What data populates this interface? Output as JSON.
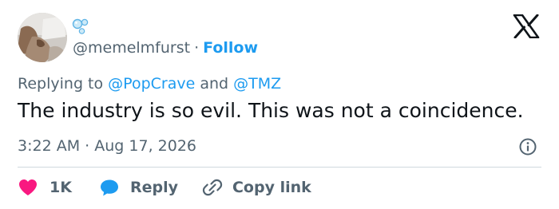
{
  "tweet": {
    "author": {
      "handle": "@memelmfurst",
      "follow_label": "Follow",
      "display_name_icon": "bubbles-emoji-icon"
    },
    "reply_context": {
      "prefix": "Replying to",
      "conjunction": "and",
      "mentions": [
        "@PopCrave",
        "@TMZ"
      ]
    },
    "text": "The industry is so evil. This was not a coincidence.",
    "timestamp": {
      "time": "3:22 AM",
      "separator": "·",
      "date": "Aug 17, 2026"
    },
    "actions": {
      "like_count": "1K",
      "reply_label": "Reply",
      "copy_link_label": "Copy link"
    }
  },
  "icons": {
    "like": "heart-icon",
    "reply": "speech-bubble-icon",
    "copy": "link-icon",
    "info": "info-icon",
    "brand": "x-logo-icon"
  },
  "colors": {
    "accent": "#1d9bf0",
    "like": "#f91880",
    "text": "#0f1419",
    "secondary_text": "#536471",
    "divider": "#cfd9de"
  }
}
